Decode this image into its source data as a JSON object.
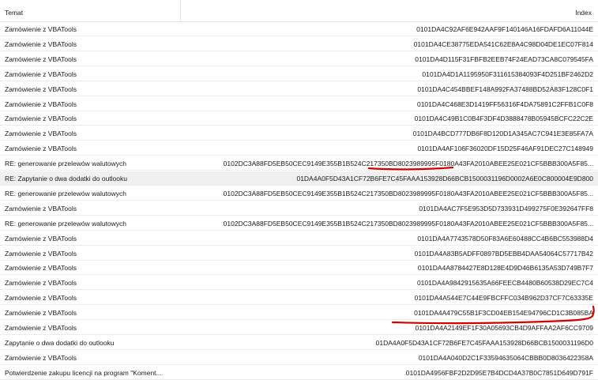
{
  "columns": {
    "subject": "Temat",
    "index": "Index"
  },
  "rows": [
    {
      "subject": "Zamówienie z VBATools",
      "index": "0101DA4C92AF6E942AAF9F140146A16FDAFD6A11044E"
    },
    {
      "subject": "Zamówienie z VBATools",
      "index": "0101DA4CE38775EDA541C62E8A4C98D04DE1EC07F814"
    },
    {
      "subject": "Zamówienie z VBATools",
      "index": "0101DA4D115F31FBFB2EEB74F24EAD73CA8C079545FA"
    },
    {
      "subject": "Zamówienie z VBATools",
      "index": "0101DA4D1A1195950F311615384093F4D251BF2462D2"
    },
    {
      "subject": "Zamówienie z VBATools",
      "index": "0101DA4C454BBEF148A992FA37488BD52A83F128C0F1"
    },
    {
      "subject": "Zamówienie z VBATools",
      "index": "0101DA4C468E3D1419FF56316F4DA75891C2FFB1C0F8"
    },
    {
      "subject": "Zamówienie z VBATools",
      "index": "0101DA4C49B1C0B4F3DF4D3888478B05945BCFC22C2E"
    },
    {
      "subject": "Zamówienie z VBATools",
      "index": "0101DA4BCD777DB6F8D120D1A345AC7C941E3E85FA7A"
    },
    {
      "subject": "Zamówienie z VBATools",
      "index": "0101DA4AF106F36020DF15D25F46AF91DEC27C148949"
    },
    {
      "subject": "RE: generowanie przelewów walutowych",
      "index": "0102DC3A88FD5EB50CEC9149E355B1B524C217350BD8023989995F0180A43FA2010ABEE25E021CF5BBB300A5F85..."
    },
    {
      "subject": "RE: Zapytanie o dwa dodatki do outlooku",
      "index": "01DA4A0F5D43A1CF72B6FE7C45FAAA153928D66BCB1500031196D0002A6E0C800004E9D800",
      "selected": true
    },
    {
      "subject": "RE: generowanie przelewów walutowych",
      "index": "0102DC3A88FD5EB50CEC9149E355B1B524C217350BD8023989995F0180A43FA2010ABEE25E021CF5BBB300A5F85..."
    },
    {
      "subject": "Zamówienie z VBATools",
      "index": "0101DA4AC7F5E953D5D733931D499275F0E392647FF8"
    },
    {
      "subject": "RE: generowanie przelewów walutowych",
      "index": "0102DC3A88FD5EB50CEC9149E355B1B524C217350BD8023989995F0180A43FA2010ABEE25E021CF5BBB300A5F85..."
    },
    {
      "subject": "Zamówienie z VBATools",
      "index": "0101DA4A7743578D50F83A6E60488CC4B6BC553988D4"
    },
    {
      "subject": "Zamówienie z VBATools",
      "index": "0101DA4A83B5ADFF0897BD5EBB4DAA54064C57717B42"
    },
    {
      "subject": "Zamówienie z VBATools",
      "index": "0101DA4A8784427E8D128E4D9D46B6135A53D749B7F7"
    },
    {
      "subject": "Zamówienie z VBATools",
      "index": "0101DA4A9842915635A66FEECB4480B60538D29EC7C4"
    },
    {
      "subject": "Zamówienie z VBATools",
      "index": "0101DA4A544E7C44E9FBCFFC034B962D37CF7C63335E"
    },
    {
      "subject": "Zamówienie z VBATools",
      "index": "0101DA4A479C55B1F3CD04EB154E94796CD1C3B085BA"
    },
    {
      "subject": "Zamówienie z VBATools",
      "index": "0101DA4A2149EF1F30A05693CB4D9AFFAA2AF6CC9709"
    },
    {
      "subject": "Zapytanie o dwa dodatki do outlooku",
      "index": "01DA4A0F5D43A1CF72B6FE7C45FAAA153928D66BCB1500031196D0"
    },
    {
      "subject": "Zamówienie z VBATools",
      "index": "0101DA4A040D2C1F33594635064CBBB0D8036422358A"
    },
    {
      "subject": "Potwierdzenie zakupu licencji na program \"Koment...",
      "index": "0101DA4956FBF2D2D95E7B4DCD4A37B0C7851D649D791F"
    }
  ],
  "annotation_color": "#d40000"
}
